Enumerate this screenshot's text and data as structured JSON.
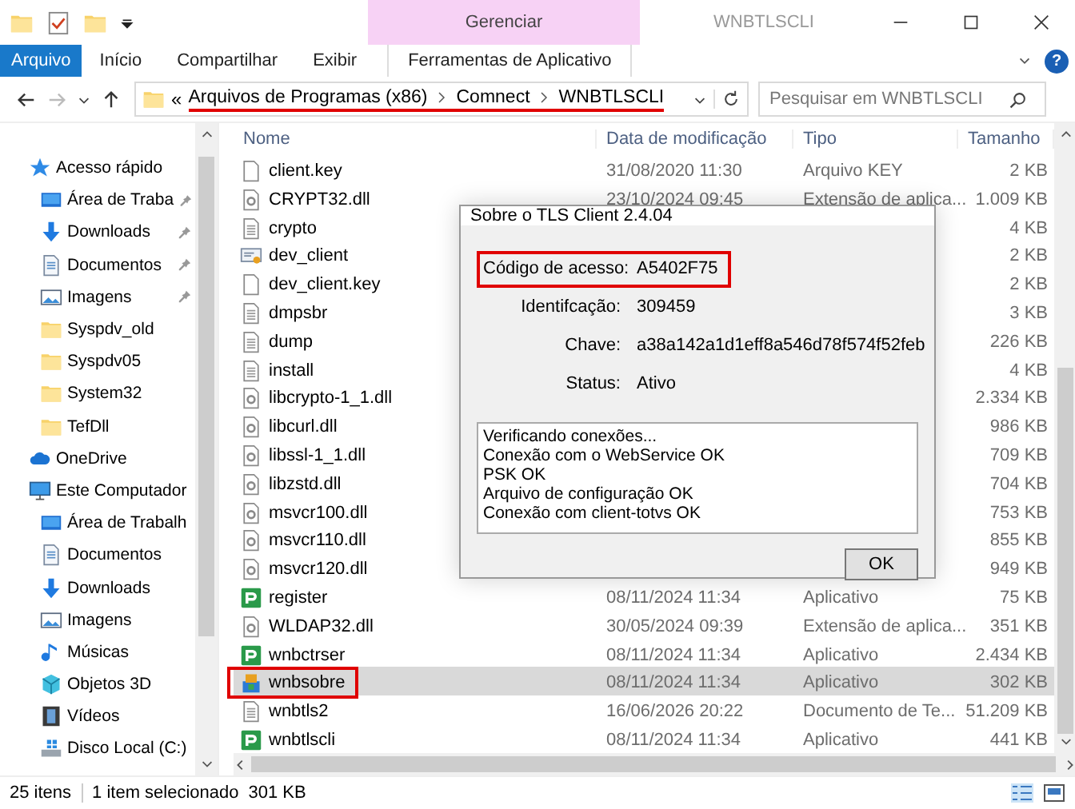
{
  "window": {
    "title": "WNBTLSCLI",
    "context_group": "Gerenciar"
  },
  "ribbon_tabs": [
    {
      "label": "Arquivo",
      "kind": "file"
    },
    {
      "label": "Início",
      "kind": "tab"
    },
    {
      "label": "Compartilhar",
      "kind": "tab"
    },
    {
      "label": "Exibir",
      "kind": "tab"
    },
    {
      "label": "Ferramentas de Aplicativo",
      "kind": "context"
    }
  ],
  "help": "?",
  "address_bar": {
    "overflow": "«",
    "path": [
      "Arquivos de Programas (x86)",
      "Comnect",
      "WNBTLSCLI"
    ],
    "annotated": true
  },
  "search": {
    "placeholder": "Pesquisar em WNBTLSCLI"
  },
  "sidebar": [
    {
      "label": "Acesso rápido",
      "kind": "star",
      "children": [
        {
          "label": "Área de Traba",
          "kind": "desktop",
          "pinned": true
        },
        {
          "label": "Downloads",
          "kind": "download",
          "pinned": true
        },
        {
          "label": "Documentos",
          "kind": "document",
          "pinned": true
        },
        {
          "label": "Imagens",
          "kind": "pictures",
          "pinned": true
        },
        {
          "label": "Syspdv_old",
          "kind": "folder",
          "pinned": false
        },
        {
          "label": "Syspdv05",
          "kind": "folder",
          "pinned": false
        },
        {
          "label": "System32",
          "kind": "folder",
          "pinned": false
        },
        {
          "label": "TefDll",
          "kind": "folder",
          "pinned": false
        }
      ]
    },
    {
      "label": "OneDrive",
      "kind": "cloud"
    },
    {
      "label": "Este Computador",
      "kind": "computer",
      "children": [
        {
          "label": "Área de Trabalh",
          "kind": "desktop",
          "pinned": false
        },
        {
          "label": "Documentos",
          "kind": "document",
          "pinned": false
        },
        {
          "label": "Downloads",
          "kind": "download",
          "pinned": false
        },
        {
          "label": "Imagens",
          "kind": "pictures",
          "pinned": false
        },
        {
          "label": "Músicas",
          "kind": "music",
          "pinned": false
        },
        {
          "label": "Objetos 3D",
          "kind": "cube",
          "pinned": false
        },
        {
          "label": "Vídeos",
          "kind": "video",
          "pinned": false
        },
        {
          "label": "Disco Local (C:)",
          "kind": "drive",
          "pinned": false
        }
      ]
    }
  ],
  "columns": [
    "Nome",
    "Data de modificação",
    "Tipo",
    "Tamanho"
  ],
  "files": [
    {
      "name": "client.key",
      "kind": "blank",
      "date": "31/08/2020 11:30",
      "type": "Arquivo KEY",
      "size": "2 KB",
      "selected": false,
      "annotated": false
    },
    {
      "name": "CRYPT32.dll",
      "kind": "dll",
      "date": "23/10/2024 09:45",
      "type": "Extensão de aplica...",
      "size": "1.009 KB",
      "selected": false,
      "annotated": false
    },
    {
      "name": "crypto",
      "kind": "text",
      "size": "4 KB",
      "selected": false,
      "annotated": false
    },
    {
      "name": "dev_client",
      "kind": "cert",
      "size": "2 KB",
      "selected": false,
      "annotated": false
    },
    {
      "name": "dev_client.key",
      "kind": "blank",
      "size": "2 KB",
      "selected": false,
      "annotated": false
    },
    {
      "name": "dmpsbr",
      "kind": "text",
      "size": "3 KB",
      "selected": false,
      "annotated": false
    },
    {
      "name": "dump",
      "kind": "text",
      "size": "226 KB",
      "selected": false,
      "annotated": false
    },
    {
      "name": "install",
      "kind": "text",
      "size": "4 KB",
      "selected": false,
      "annotated": false
    },
    {
      "name": "libcrypto-1_1.dll",
      "kind": "dll",
      "size": "2.334 KB",
      "selected": false,
      "annotated": false
    },
    {
      "name": "libcurl.dll",
      "kind": "dll",
      "size": "986 KB",
      "selected": false,
      "annotated": false
    },
    {
      "name": "libssl-1_1.dll",
      "kind": "dll",
      "size": "709 KB",
      "selected": false,
      "annotated": false
    },
    {
      "name": "libzstd.dll",
      "kind": "dll",
      "size": "704 KB",
      "selected": false,
      "annotated": false
    },
    {
      "name": "msvcr100.dll",
      "kind": "dll",
      "size": "753 KB",
      "selected": false,
      "annotated": false
    },
    {
      "name": "msvcr110.dll",
      "kind": "dll",
      "size": "855 KB",
      "selected": false,
      "annotated": false
    },
    {
      "name": "msvcr120.dll",
      "kind": "dll",
      "size": "949 KB",
      "selected": false,
      "annotated": false
    },
    {
      "name": "register",
      "kind": "app",
      "date": "08/11/2024 11:34",
      "type": "Aplicativo",
      "size": "75 KB",
      "selected": false,
      "annotated": false
    },
    {
      "name": "WLDAP32.dll",
      "kind": "dll",
      "date": "30/05/2024 09:39",
      "type": "Extensão de aplica...",
      "size": "351 KB",
      "selected": false,
      "annotated": false
    },
    {
      "name": "wnbctrser",
      "kind": "app",
      "date": "08/11/2024 11:34",
      "type": "Aplicativo",
      "size": "2.434 KB",
      "selected": false,
      "annotated": false
    },
    {
      "name": "wnbsobre",
      "kind": "setup",
      "date": "08/11/2024 11:34",
      "type": "Aplicativo",
      "size": "302 KB",
      "selected": true,
      "annotated": true
    },
    {
      "name": "wnbtls2",
      "kind": "text",
      "date": "16/06/2026 20:22",
      "type": "Documento de Te...",
      "size": "51.209 KB",
      "selected": false,
      "annotated": false
    },
    {
      "name": "wnbtlscli",
      "kind": "app",
      "date": "08/11/2024 11:34",
      "type": "Aplicativo",
      "size": "441 KB",
      "selected": false,
      "annotated": false
    }
  ],
  "dialog": {
    "title": "Sobre o TLS Client 2.4.04",
    "fields": [
      {
        "label": "Código de acesso:",
        "value": "A5402F75",
        "annotated": true
      },
      {
        "label": "Identifcação:",
        "value": "309459",
        "annotated": false
      },
      {
        "label": "Chave:",
        "value": "a38a142a1d1eff8a546d78f574f52feb",
        "annotated": false
      },
      {
        "label": "Status:",
        "value": "Ativo",
        "annotated": false
      }
    ],
    "log": [
      "Verificando conexões...",
      "Conexão com o WebService OK",
      "PSK OK",
      "Arquivo de configuração OK",
      "Conexão com client-totvs OK"
    ],
    "button": "OK"
  },
  "status_bar": {
    "count": "25 itens",
    "selection": "1 item selecionado",
    "selection_size": "301 KB"
  }
}
